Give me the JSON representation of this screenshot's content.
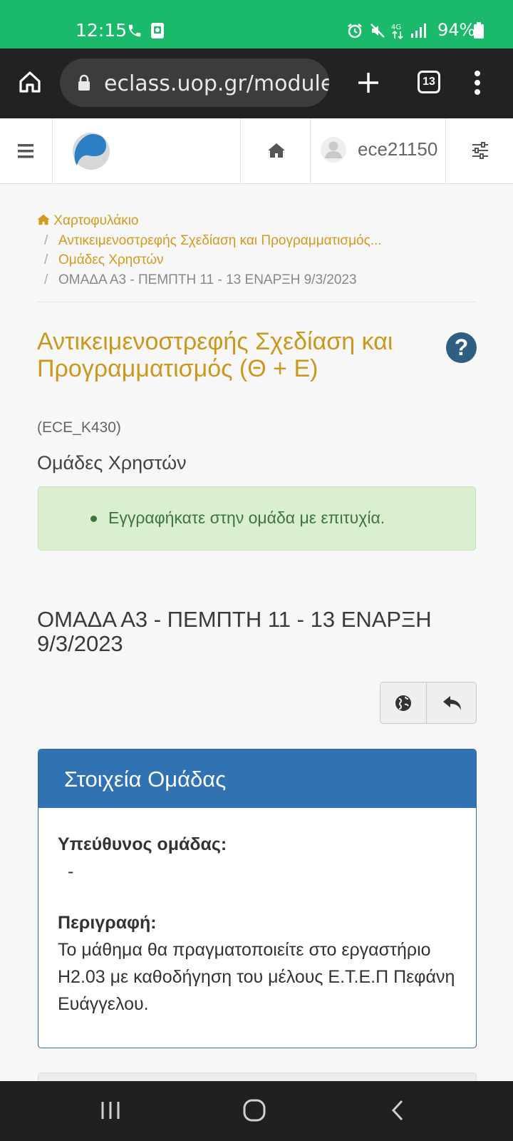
{
  "status_bar": {
    "time": "12:15",
    "battery": "94%",
    "icons": [
      "phone-icon",
      "screenshot-icon",
      "alarm-icon",
      "mute-icon",
      "4g-icon",
      "signal-icon",
      "battery-icon"
    ]
  },
  "browser": {
    "url": "eclass.uop.gr/module",
    "tab_count": "13",
    "icons": [
      "home-icon",
      "lock-icon",
      "new-tab-icon",
      "menu-icon"
    ]
  },
  "site_nav": {
    "username": "ece21150",
    "icons": [
      "hamburger-icon",
      "eclass-logo",
      "home-icon",
      "user-avatar-icon",
      "sliders-icon"
    ]
  },
  "breadcrumb": {
    "home": "Χαρτοφυλάκιο",
    "items": [
      "Αντικειμενοστρεφής Σχεδίαση και Προγραμματισμός...",
      "Ομάδες Χρηστών",
      "ΟΜΑΔΑ Α3 - ΠΕΜΠΤΗ 11 - 13 ΕΝΑΡΞΗ 9/3/2023"
    ]
  },
  "course": {
    "title": "Αντικειμενοστρεφής Σχεδίαση και Προγραμματισμός (Θ + Ε)",
    "code": "(ECE_K430)"
  },
  "section_title": "Ομάδες Χρηστών",
  "alert": {
    "message": "Εγγραφήκατε στην ομάδα με επιτυχία.",
    "color": "#3c763d"
  },
  "group": {
    "title": "ΟΜΑΔΑ Α3 - ΠΕΜΠΤΗ 11 - 13 ΕΝΑΡΞΗ 9/3/2023",
    "actions": [
      "globe-icon",
      "back-arrow-icon"
    ]
  },
  "panel": {
    "heading": "Στοιχεία Ομάδας",
    "leader_label": "Υπεύθυνος ομάδας:",
    "leader_value": "-",
    "description_label": "Περιγραφή:",
    "description": "Το μάθημα θα πραγματοποιείτε στο εργαστήριο Η2.03 με καθοδήγηση του μέλους Ε.Τ.Ε.Π Πεφάνη Ευάγγελου."
  },
  "colors": {
    "status_bar": "#1aba6a",
    "accent": "#c9981c",
    "panel_header": "#3172b2",
    "alert_bg": "#d9efcf"
  }
}
